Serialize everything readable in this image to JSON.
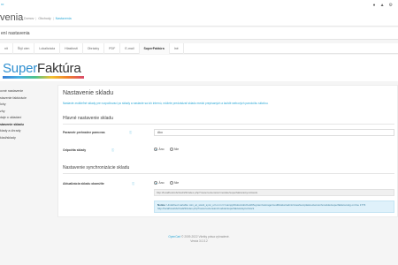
{
  "topbar": {
    "logo_fragment": "ıo",
    "page_title": "venia",
    "breadcrumb": [
      "Domov",
      "Obchody",
      "Nastavenia"
    ],
    "icons": [
      "user-icon",
      "bell-icon",
      "gear-icon"
    ]
  },
  "header2": {
    "title": "ení nastavenia"
  },
  "tabs": [
    "nit",
    "Štýl cien",
    "Lokalizácia",
    "Hlasitosti",
    "Obrázky",
    "PDF",
    "E-mail",
    "SuperFaktúra",
    "Iné"
  ],
  "brand": {
    "part1": "Super",
    "part2": "Faktúra"
  },
  "sidebar": {
    "items": [
      "ovné nastavenie",
      "stavenie faktúrácie",
      "lohy",
      "zhy",
      "daje o ukladaní",
      "stavenie skladu",
      "klady a úhrady",
      "klad/sklady"
    ],
    "active_index": 5
  },
  "panel": {
    "title": "Nastavenie skladu",
    "description": "Nastavte zrušiteľné sklady pre rozpočtovací po sklady a nastavte sa ich internú, môžete predvádzať skladu medzi prepísaných a každé webových paroločku sklaťou.",
    "section1": "Hlavné nastavenie skladu",
    "row1_label": "Parametr prehradne pamcvas",
    "row1_value": "Ako",
    "row2_label": "Odpočíta sklady",
    "row2_yes": "Áno",
    "row2_no": "Nie",
    "section2": "Nastavenie synchronizácie skladu",
    "row3_label": "Aktualizácia skladu okamžite",
    "row3_yes": "Áno",
    "row3_no": "Nie",
    "url": "http://localhost/obchod/23/index.php?route=extension/module/superfaktura/sync/stock",
    "notice_label": "Notice",
    "notice_text": ": Undefined variable: stm_at_stock_sync_url on in C:\\xampp\\htdocs\\obchod23\\system\\storage\\modification\\admin\\view\\template\\extension\\module\\superfaktura.twig on line 1773 http://localhost/obchod23/index.php?route=extension/module/superfaktura/sync/stock"
  },
  "footer": {
    "link": "OpenCart",
    "text": "© 2009-2022 Všetky práva vyhradené.",
    "version": "Verzia 3.0.3.2"
  }
}
